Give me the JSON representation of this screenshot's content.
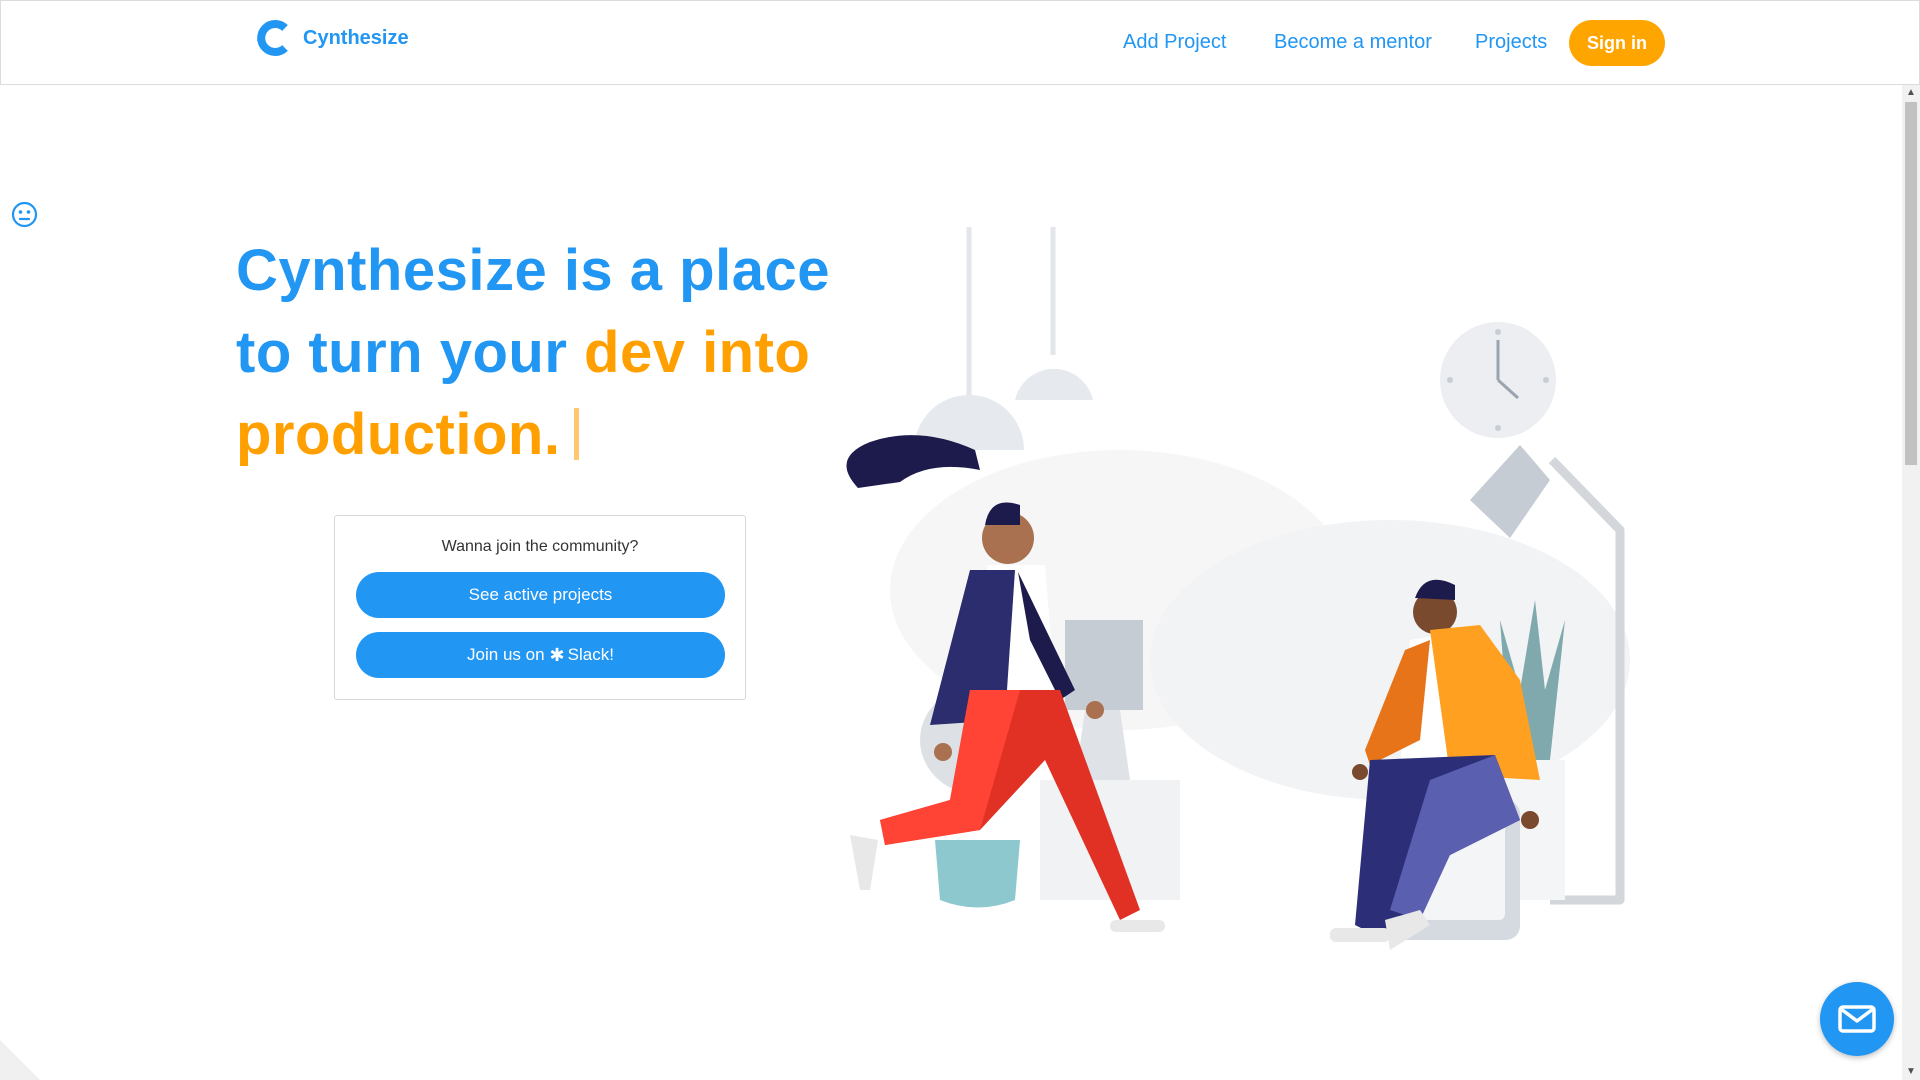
{
  "header": {
    "brand": "Cynthesize",
    "nav": {
      "add_project": "Add Project",
      "become_mentor": "Become a mentor",
      "projects": "Projects"
    },
    "signin_label": "Sign in"
  },
  "hero": {
    "line1": "Cynthesize is a place",
    "line2_blue": "to turn your ",
    "line2_orange": "dev into",
    "line3": "production."
  },
  "community": {
    "title": "Wanna join the community?",
    "active_projects_label": "See active projects",
    "slack_prefix": "Join us on",
    "slack_suffix": "Slack!"
  },
  "icons": {
    "feedback": "smiley-face-icon",
    "mail": "mail-icon",
    "slack": "slack-icon",
    "logo": "cynthesize-logo-icon"
  },
  "colors": {
    "primary": "#2196f3",
    "accent": "#ffa500"
  }
}
